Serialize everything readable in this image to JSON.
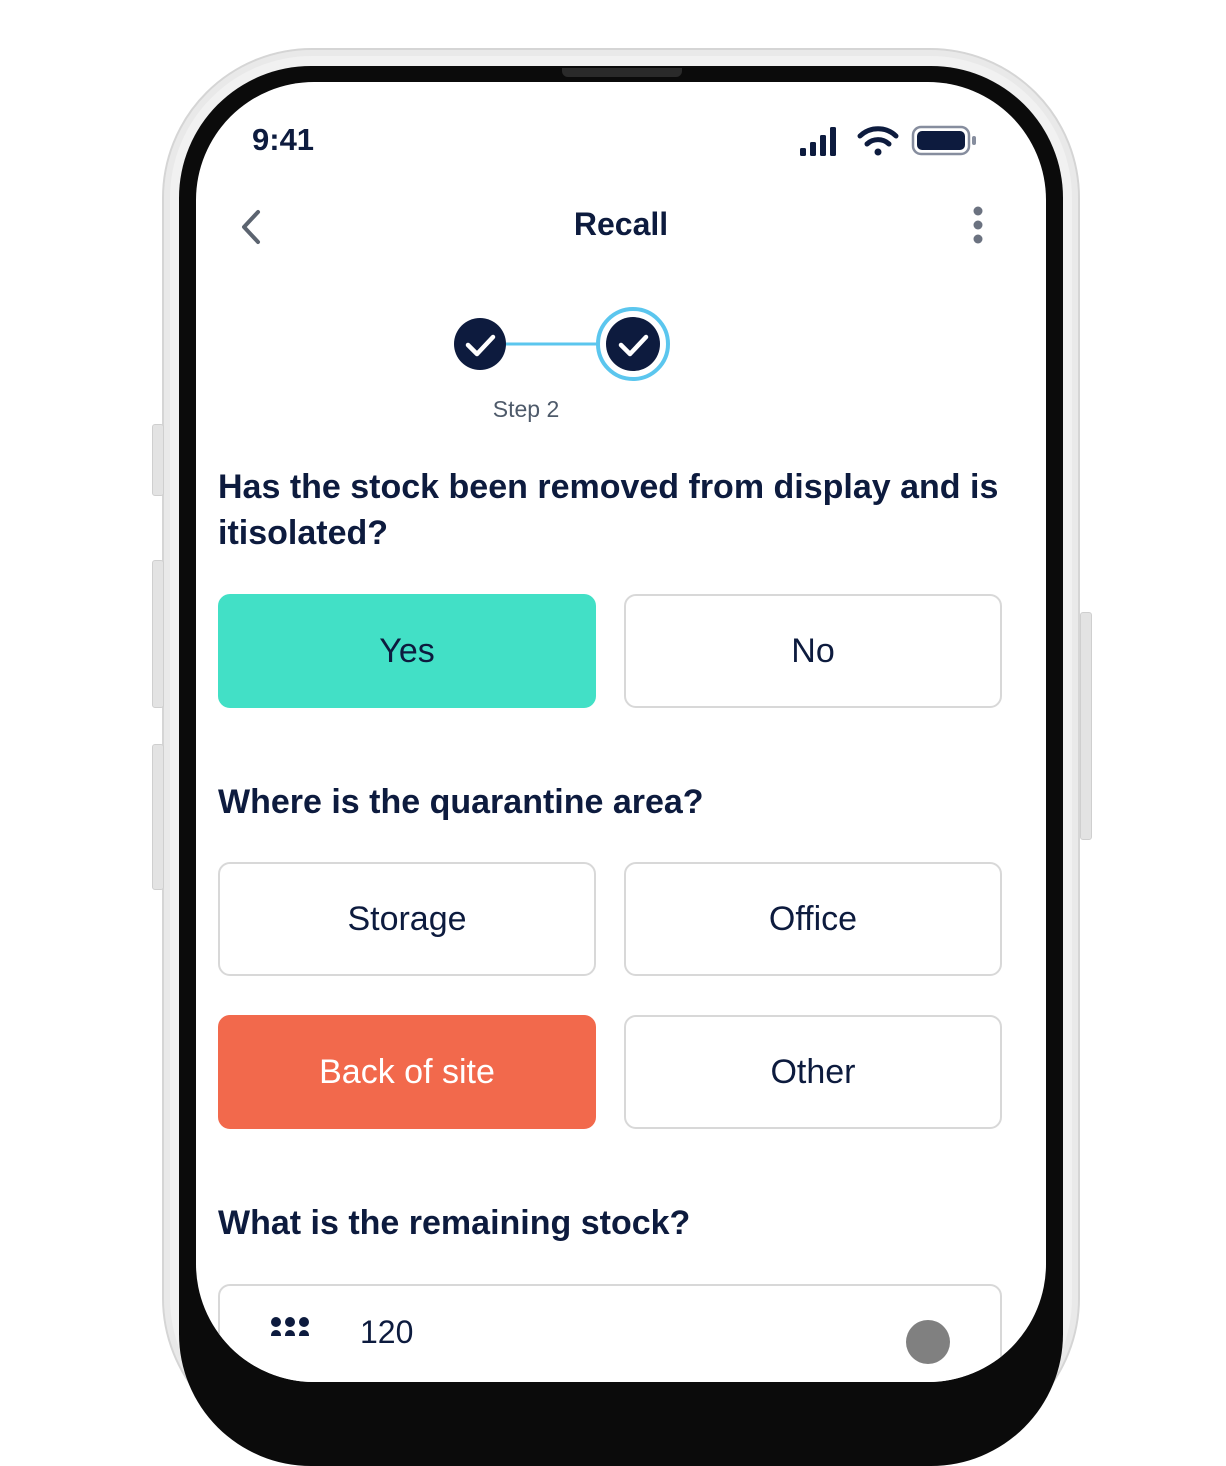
{
  "status_bar": {
    "time": "9:41"
  },
  "nav": {
    "title": "Recall"
  },
  "stepper": {
    "current_label": "Step 2",
    "steps_completed": 2,
    "total_steps": 2
  },
  "questions": {
    "q1": {
      "text": "Has the stock been removed from display and is itisolated?",
      "options": {
        "yes": "Yes",
        "no": "No"
      },
      "selected": "Yes"
    },
    "q2": {
      "text": "Where is the quarantine area?",
      "options": {
        "storage": "Storage",
        "office": "Office",
        "back_of_site": "Back of site",
        "other": "Other"
      },
      "selected": "Back of site"
    },
    "q3": {
      "text": "What is the remaining stock?",
      "value": "120"
    }
  },
  "colors": {
    "navy": "#0d1b3e",
    "selected_yes": "#42e0c6",
    "selected_location": "#f2694c",
    "step_ring": "#5bc6ee",
    "option_border": "#d8d8d8"
  }
}
